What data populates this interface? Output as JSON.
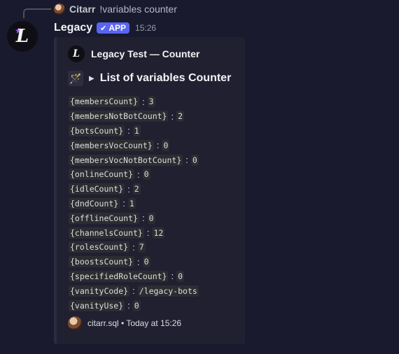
{
  "reply": {
    "author": "Citarr",
    "text": "!variables counter"
  },
  "message": {
    "username": "Legacy",
    "badge": "APP",
    "timestamp": "15:26"
  },
  "embed": {
    "author": "Legacy Test — Counter",
    "title": "List of variables Counter",
    "variables": [
      {
        "key": "{membersCount}",
        "value": "3"
      },
      {
        "key": "{membersNotBotCount}",
        "value": "2"
      },
      {
        "key": "{botsCount}",
        "value": "1"
      },
      {
        "key": "{membersVocCount}",
        "value": "0"
      },
      {
        "key": "{membersVocNotBotCount}",
        "value": "0"
      },
      {
        "key": "{onlineCount}",
        "value": "0"
      },
      {
        "key": "{idleCount}",
        "value": "2"
      },
      {
        "key": "{dndCount}",
        "value": "1"
      },
      {
        "key": "{offlineCount}",
        "value": "0"
      },
      {
        "key": "{channelsCount}",
        "value": "12"
      },
      {
        "key": "{rolesCount}",
        "value": "7"
      },
      {
        "key": "{boostsCount}",
        "value": "0"
      },
      {
        "key": "{specifiedRoleCount}",
        "value": "0"
      },
      {
        "key": "{vanityCode}",
        "value": "/legacy-bots"
      },
      {
        "key": "{vanityUse}",
        "value": "0"
      }
    ],
    "footer": "citarr.sql • Today at 15:26"
  },
  "colors": {
    "background": "#1a1a2e",
    "embed_bg": "#202031",
    "badge": "#5865f2"
  }
}
